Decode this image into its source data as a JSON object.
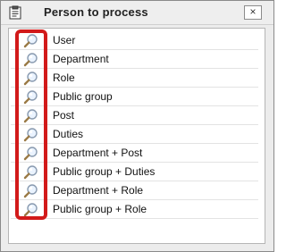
{
  "dialog": {
    "title": "Person to process",
    "close_label": "×"
  },
  "list": {
    "items": [
      {
        "label": "User",
        "icon": "magnifier-icon"
      },
      {
        "label": "Department",
        "icon": "magnifier-icon"
      },
      {
        "label": "Role",
        "icon": "magnifier-icon"
      },
      {
        "label": "Public group",
        "icon": "magnifier-icon"
      },
      {
        "label": "Post",
        "icon": "magnifier-icon"
      },
      {
        "label": "Duties",
        "icon": "magnifier-icon"
      },
      {
        "label": "Department + Post",
        "icon": "magnifier-icon"
      },
      {
        "label": "Public group + Duties",
        "icon": "magnifier-icon"
      },
      {
        "label": "Department + Role",
        "icon": "magnifier-icon"
      },
      {
        "label": "Public group + Role",
        "icon": "magnifier-icon"
      }
    ]
  },
  "colors": {
    "highlight": "#d21a1a"
  }
}
